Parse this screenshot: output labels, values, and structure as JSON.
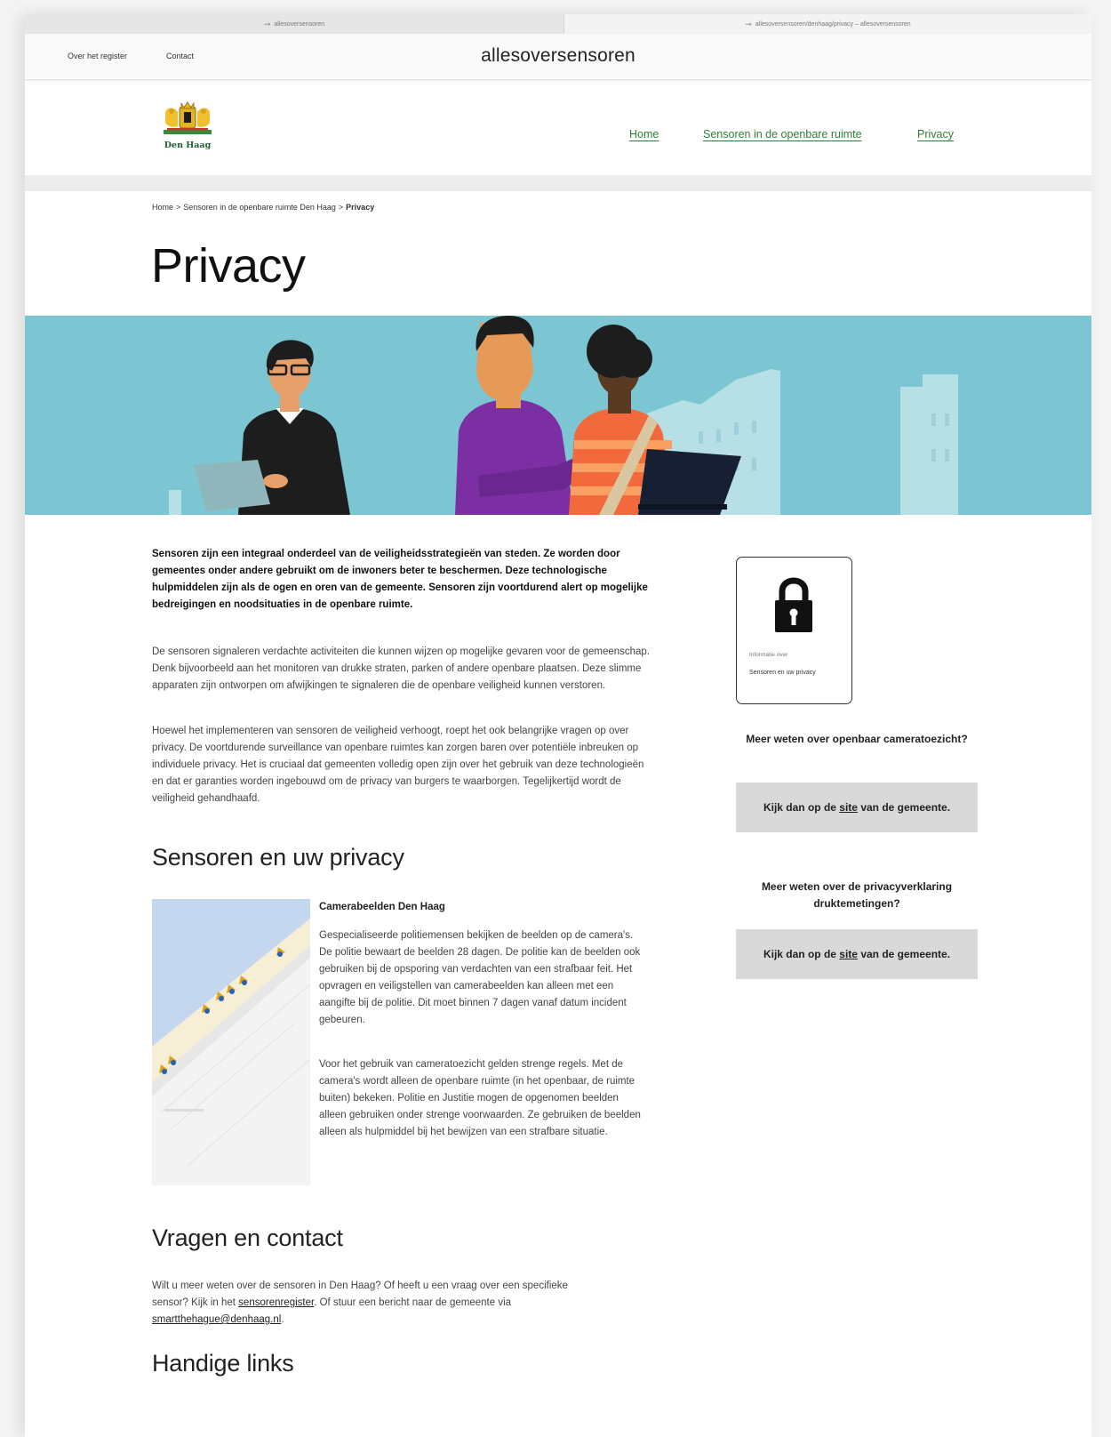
{
  "browser": {
    "tabs": [
      {
        "label": "allesoversensoren"
      },
      {
        "label": "allesoversensoren/denhaag/privacy – allesoversensoren"
      }
    ]
  },
  "registry_header": {
    "links": [
      "Over het register",
      "Contact"
    ],
    "brand": "allesoversensoren"
  },
  "site_header": {
    "logo_text": "Den Haag",
    "nav": [
      "Home",
      "Sensoren in de openbare ruimte",
      "Privacy"
    ]
  },
  "breadcrumb": {
    "items": [
      "Home",
      "Sensoren in de openbare ruimte Den Haag",
      "Privacy"
    ],
    "separator": ">"
  },
  "page_title": "Privacy",
  "intro": {
    "lead": "Sensoren zijn een integraal onderdeel van de veiligheidsstrategieën van steden. Ze worden door gemeentes onder andere gebruikt om de inwoners beter te beschermen. Deze technologische hulpmiddelen zijn als de ogen en oren van de gemeente. Sensoren zijn voortdurend alert op mogelijke bedreigingen en noodsituaties in de openbare ruimte.",
    "p1": "De sensoren signaleren verdachte activiteiten die kunnen wijzen op mogelijke gevaren voor de gemeenschap. Denk bijvoorbeeld aan het monitoren van drukke straten, parken of andere openbare plaatsen. Deze slimme apparaten zijn ontworpen om afwijkingen te signaleren die de openbare veiligheid kunnen verstoren.",
    "p2": "Hoewel het implementeren van sensoren de veiligheid verhoogt, roept het ook belangrijke vragen op over privacy. De voortdurende surveillance van openbare ruimtes kan zorgen baren over potentiële inbreuken op individuele privacy. Het is cruciaal dat gemeenten volledig open zijn over het gebruik van deze technologieën en dat er garanties worden ingebouwd om de privacy van burgers te waarborgen. Tegelijkertijd wordt de veiligheid gehandhaafd."
  },
  "section_privacy": {
    "heading": "Sensoren en uw privacy",
    "camera_heading": "Camerabeelden Den Haag",
    "p1": "Gespecialiseerde politiemensen bekijken de beelden op de camera's. De politie bewaart de beelden 28 dagen. De politie kan de beelden ook gebruiken bij de opsporing van verdachten van een strafbaar feit. Het opvragen en veiligstellen van camerabeelden kan alleen met een aangifte bij de politie. Dit moet binnen 7 dagen vanaf datum incident gebeuren.",
    "p2": "Voor het gebruik van cameratoezicht gelden strenge regels. Met de camera's wordt alleen de openbare ruimte (in het openbaar, de ruimte buiten) bekeken. Politie en Justitie mogen de opgenomen beelden alleen gebruiken onder strenge voorwaarden. Ze gebruiken de beelden alleen als hulpmiddel bij het bewijzen van een strafbare situatie."
  },
  "section_contact": {
    "heading": "Vragen en contact",
    "text_before": "Wilt u meer weten over de sensoren in Den Haag? Of heeft u een vraag over een specifieke sensor? Kijk in het ",
    "link1": "sensorenregister",
    "text_middle": ". Of stuur een bericht naar de gemeente via ",
    "link2": "smartthehague@denhaag.nl",
    "text_after": "."
  },
  "section_links": {
    "heading": "Handige links"
  },
  "sidebar": {
    "card": {
      "topline": "Informatie over",
      "title": "Sensoren en uw privacy"
    },
    "q1": "Meer weten over openbaar cameratoezicht?",
    "btn1": {
      "pre": "Kijk dan op de ",
      "link": "site",
      "post": " van de gemeente."
    },
    "q2": "Meer weten over de privacyverklaring druktemetingen?",
    "btn2": {
      "pre": "Kijk dan op de ",
      "link": "site",
      "post": " van de gemeente."
    }
  },
  "colors": {
    "hero_bg": "#7cc6d4",
    "nav_link": "#2c7f3a",
    "button_bg": "#d9d9d9",
    "person_purple": "#7b2fa3",
    "person_orange": "#f26a3b"
  },
  "icons": [
    "link-icon",
    "lock-icon",
    "den-haag-crest-logo",
    "beach-map-image"
  ]
}
